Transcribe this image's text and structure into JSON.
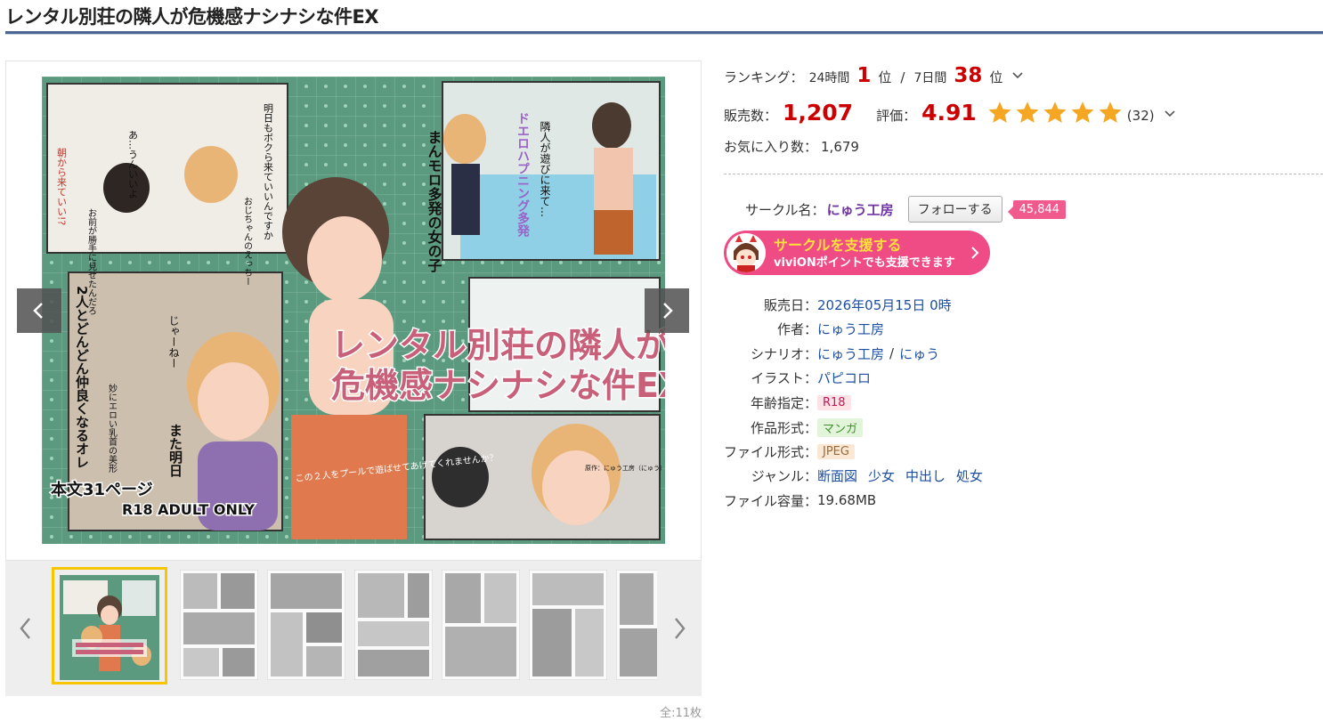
{
  "page": {
    "title": "レンタル別荘の隣人が危機感ナシナシな件EX"
  },
  "gallery": {
    "total_label": "全:11枚",
    "thumbnails": [
      "thumb-1",
      "thumb-2",
      "thumb-3",
      "thumb-4",
      "thumb-5",
      "thumb-6",
      "thumb-7"
    ],
    "active_index": 0,
    "cover_text": {
      "title_line1": "レンタル別荘の隣人が",
      "title_line2": "危機感ナシナシな件EX",
      "pages": "本文31ページ",
      "rating": "R18 ADULT ONLY",
      "tagline": "まんモロ多発の女の子",
      "purple_tag": "ドエロハプニング多発",
      "bubble_1": "また明日",
      "bubble_2": "2人とどんどん仲良くなるオレ",
      "bubble_3": "じゃーねー",
      "bubble_4": "隣人が遊びに来て…",
      "bubble_5": "明日もボクら来ていいんですか",
      "bubble_6": "あ…うんいいよ",
      "bubble_7": "朝から来ていい!?",
      "bubble_8": "お前が勝手に見せたんだろ",
      "bubble_9": "おじちゃんのえっちー",
      "bubble_10": "妙にエロい乳首の美形",
      "bubble_11": "この２人をプールで遊ばせてあげてくれませんか？",
      "credit": "原作：にゅう工房（にゅう） 作画：パピコロ"
    }
  },
  "info": {
    "ranking_label": "ランキング：",
    "ranking_24h_label": "24時間",
    "ranking_24h_value": "1",
    "ranking_unit_1": "位",
    "ranking_sep": "/",
    "ranking_7d_label": "7日間",
    "ranking_7d_value": "38",
    "ranking_unit_2": "位",
    "sales_label": "販売数：",
    "sales_value": "1,207",
    "rating_label": "評価：",
    "rating_value": "4.91",
    "rating_stars": 5,
    "rating_count": "(32)",
    "favorites_label": "お気に入り数：",
    "favorites_value": "1,679"
  },
  "circle": {
    "label": "サークル名：",
    "name": "にゅう工房",
    "follow_label": "フォローする",
    "followers": "45,844"
  },
  "support": {
    "main_label": "サークルを支援する",
    "sub_label": "viviONポイントでも支援できます"
  },
  "specs": {
    "release_label": "販売日：",
    "release_value": "2026年05月15日 0時",
    "author_label": "作者：",
    "author_value": "にゅう工房",
    "scenario_label": "シナリオ：",
    "scenario_value_1": "にゅう工房",
    "scenario_sep": "/",
    "scenario_value_2": "にゅう",
    "illust_label": "イラスト：",
    "illust_value": "パピコロ",
    "age_label": "年齢指定：",
    "age_value": "R18",
    "format_label": "作品形式：",
    "format_value": "マンガ",
    "file_label": "ファイル形式：",
    "file_value": "JPEG",
    "genre_label": "ジャンル：",
    "genres": [
      "断面図",
      "少女",
      "中出し",
      "処女"
    ],
    "size_label": "ファイル容量：",
    "size_value": "19.68MB"
  },
  "colors": {
    "accent_red": "#cc0000",
    "title_rule": "#4a6591",
    "link": "#1d4fa0",
    "circle_purple": "#7233a3",
    "support_pink": "#ef4b84",
    "star": "#f5a623",
    "thumb_active": "#f7c600"
  }
}
